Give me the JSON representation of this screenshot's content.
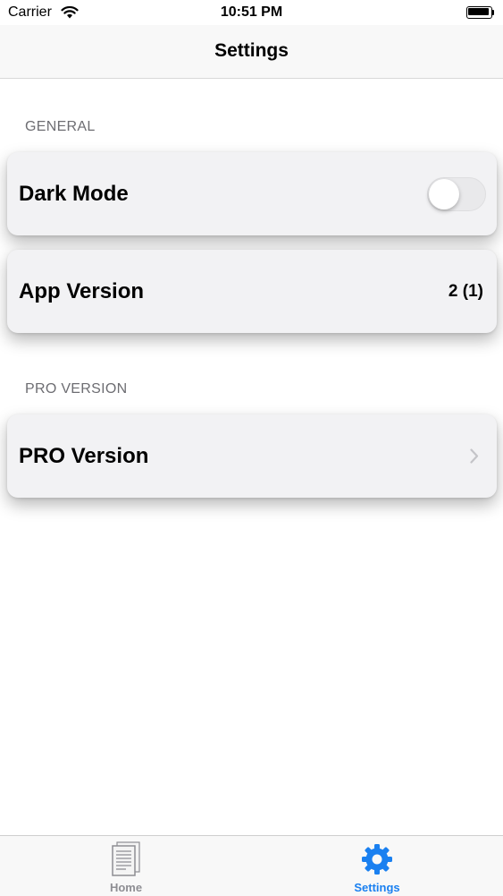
{
  "status_bar": {
    "carrier": "Carrier",
    "time": "10:51 PM"
  },
  "nav": {
    "title": "Settings"
  },
  "sections": {
    "general": {
      "header": "GENERAL",
      "dark_mode": {
        "label": "Dark Mode",
        "enabled": false
      },
      "app_version": {
        "label": "App Version",
        "value": "2 (1)"
      }
    },
    "pro": {
      "header": "PRO VERSION",
      "pro_version": {
        "label": "PRO Version"
      }
    }
  },
  "tab_bar": {
    "tabs": [
      {
        "label": "Home",
        "icon": "document-icon",
        "selected": false
      },
      {
        "label": "Settings",
        "icon": "gear-icon",
        "selected": true
      }
    ],
    "active_color": "#1a80f0",
    "inactive_color": "#8e8e93"
  }
}
